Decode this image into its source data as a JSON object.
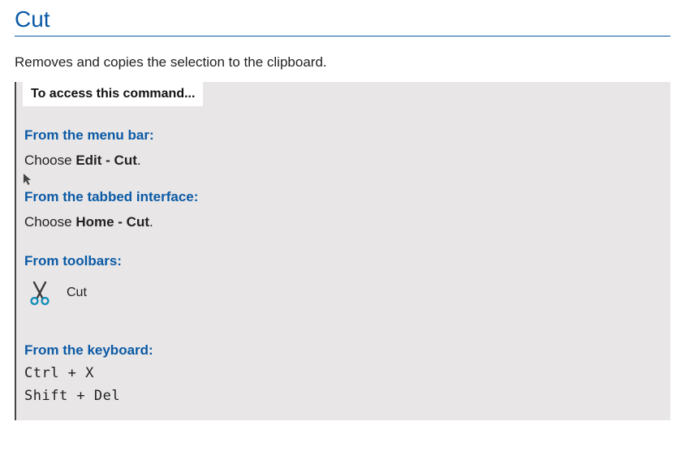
{
  "title": "Cut",
  "description": "Removes and copies the selection to the clipboard.",
  "access_tab": "To access this command...",
  "sections": {
    "menu_bar": {
      "heading": "From the menu bar:",
      "prefix": "Choose ",
      "bold": "Edit - Cut",
      "suffix": "."
    },
    "tabbed_interface": {
      "heading": "From the tabbed interface:",
      "prefix": "Choose ",
      "bold": "Home - Cut",
      "suffix": "."
    },
    "toolbars": {
      "heading": "From toolbars:",
      "icon_label": "Cut"
    },
    "keyboard": {
      "heading": "From the keyboard:",
      "shortcut1": "Ctrl + X",
      "shortcut2": "Shift + Del"
    }
  }
}
